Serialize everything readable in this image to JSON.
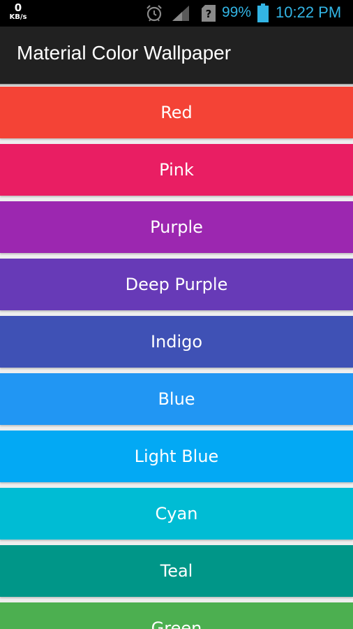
{
  "status_bar": {
    "data_rate_value": "0",
    "data_rate_unit": "KB/s",
    "battery_percent": "99%",
    "time": "10:22 PM",
    "accent_color": "#33b5e5",
    "icons": [
      "alarm-icon",
      "signal-icon",
      "no-sim-icon",
      "battery-icon"
    ]
  },
  "app_bar": {
    "title": "Material Color Wallpaper",
    "background": "#212121"
  },
  "colors": [
    {
      "name": "Red",
      "hex": "#f44336"
    },
    {
      "name": "Pink",
      "hex": "#e91e63"
    },
    {
      "name": "Purple",
      "hex": "#9c27b0"
    },
    {
      "name": "Deep Purple",
      "hex": "#673ab7"
    },
    {
      "name": "Indigo",
      "hex": "#3f51b5"
    },
    {
      "name": "Blue",
      "hex": "#2196f3"
    },
    {
      "name": "Light Blue",
      "hex": "#03a9f4"
    },
    {
      "name": "Cyan",
      "hex": "#00bcd4"
    },
    {
      "name": "Teal",
      "hex": "#009688"
    },
    {
      "name": "Green",
      "hex": "#4caf50"
    }
  ]
}
